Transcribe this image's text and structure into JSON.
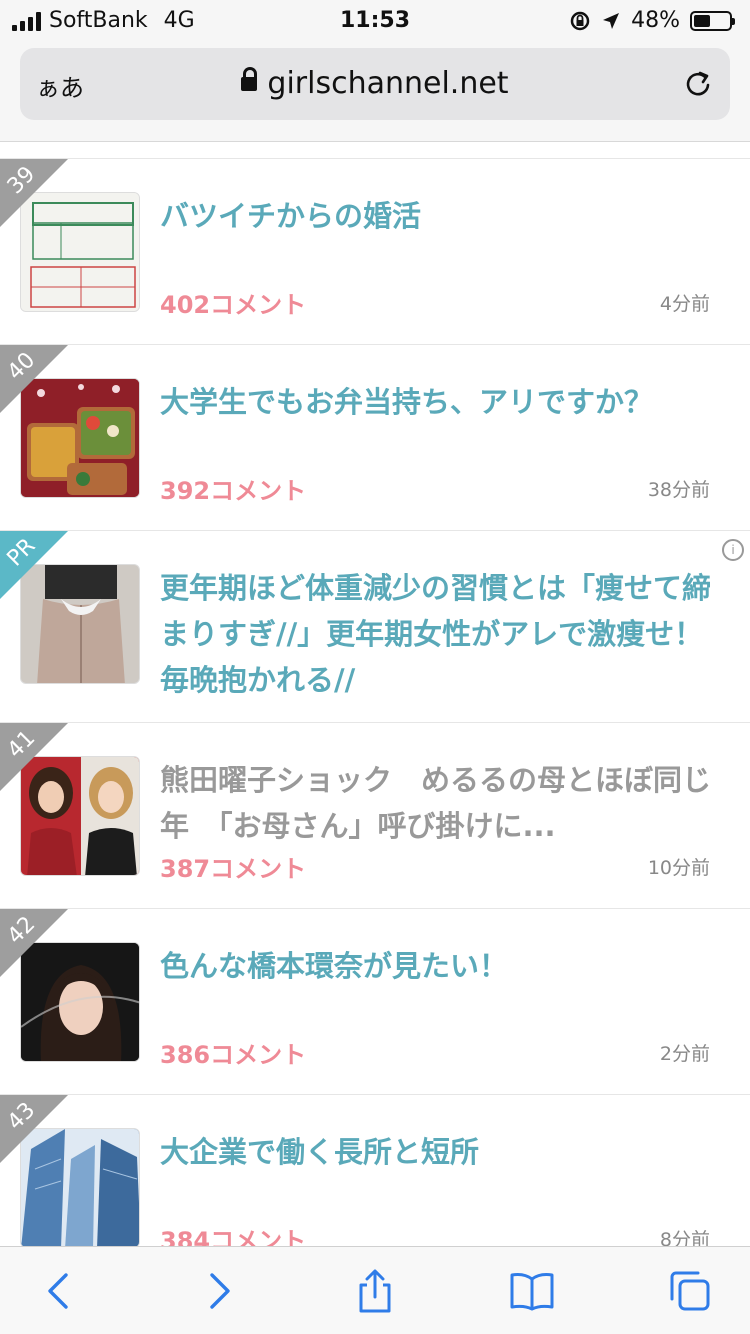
{
  "status": {
    "carrier": "SoftBank",
    "network": "4G",
    "time": "11:53",
    "battery": "48%",
    "battery_level": 0.48
  },
  "address_bar": {
    "aa": "ぁあ",
    "url": "girlschannel.net"
  },
  "topics": [
    {
      "rank": "39",
      "title": "バツイチからの婚活",
      "comments": "402コメント",
      "time": "4分前",
      "read": false,
      "thumb": "divorce-form"
    },
    {
      "rank": "40",
      "title": "大学生でもお弁当持ち、アリですか？",
      "comments": "392コメント",
      "time": "38分前",
      "read": false,
      "thumb": "bento"
    },
    {
      "rank": "PR",
      "title": "更年期ほど体重減少の習慣とは「痩せて締まりすぎ//」更年期女性がアレで激痩せ！毎晩抱かれる//",
      "comments": "",
      "time": "",
      "read": false,
      "thumb": "ad-photo"
    },
    {
      "rank": "41",
      "title": "熊田曜子ショック　めるるの母とほぼ同じ年　「お母さん」呼び掛けに...",
      "comments": "387コメント",
      "time": "10分前",
      "read": true,
      "thumb": "two-women"
    },
    {
      "rank": "42",
      "title": "色んな橋本環奈が見たい！",
      "comments": "386コメント",
      "time": "2分前",
      "read": false,
      "thumb": "portrait"
    },
    {
      "rank": "43",
      "title": "大企業で働く長所と短所",
      "comments": "384コメント",
      "time": "8分前",
      "read": false,
      "thumb": "buildings"
    }
  ],
  "colors": {
    "title": "#5aa9b9",
    "title_read": "#999999",
    "comments": "#ef8a96",
    "rank_corner": "#9e9e9e",
    "pr_corner": "#5bb8c7",
    "toolbar_icon": "#2f7ce8"
  },
  "toolbar": {
    "icons": [
      "back-icon",
      "forward-icon",
      "share-icon",
      "bookmarks-icon",
      "tabs-icon"
    ]
  }
}
